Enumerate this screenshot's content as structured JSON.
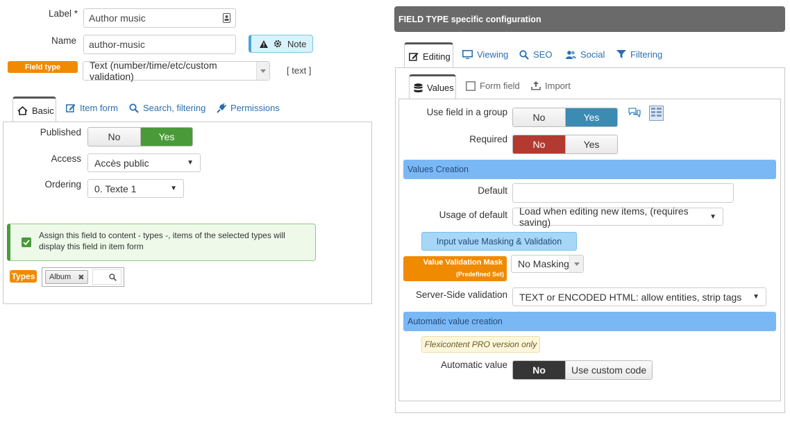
{
  "form": {
    "label_label": "Label *",
    "label_value": "Author music",
    "name_label": "Name",
    "name_value": "author-music",
    "note_label": "Note",
    "field_type_badge": "Field type",
    "field_type_value": "Text (number/time/etc/custom validation)",
    "field_type_code": "[ text ]"
  },
  "left_tabs": [
    {
      "label": "Basic",
      "icon": "home-icon"
    },
    {
      "label": "Item form",
      "icon": "edit-icon"
    },
    {
      "label": "Search, filtering",
      "icon": "search-icon"
    },
    {
      "label": "Permissions",
      "icon": "plug-icon"
    }
  ],
  "basic": {
    "published_label": "Published",
    "published_no": "No",
    "published_yes": "Yes",
    "access_label": "Access",
    "access_value": "Accès public",
    "ordering_label": "Ordering",
    "ordering_value": "0. Texte 1",
    "assign_text": "Assign this field to content - types -, items of the selected types will display this field in item form",
    "types_badge": "Types",
    "types_tag": "Album",
    "accent_green": "#4a9a3a"
  },
  "right": {
    "header": "FIELD TYPE specific configuration",
    "tabs": [
      {
        "label": "Editing",
        "icon": "edit-icon"
      },
      {
        "label": "Viewing",
        "icon": "monitor-icon"
      },
      {
        "label": "SEO",
        "icon": "search-icon"
      },
      {
        "label": "Social",
        "icon": "users-icon"
      },
      {
        "label": "Filtering",
        "icon": "filter-icon"
      }
    ],
    "subtabs": [
      {
        "label": "Values",
        "icon": "database-icon"
      },
      {
        "label": "Form field",
        "icon": "checkbox-icon"
      },
      {
        "label": "Import",
        "icon": "upload-icon"
      }
    ],
    "use_group_label": "Use field in a group",
    "use_group_no": "No",
    "use_group_yes": "Yes",
    "required_label": "Required",
    "required_no": "No",
    "required_yes": "Yes",
    "values_creation": "Values Creation",
    "default_label": "Default",
    "default_value": "",
    "usage_label": "Usage of default",
    "usage_value": "Load when editing new items, (requires saving)",
    "masking_button": "Input value Masking & Validation",
    "mask_badge_line1": "Value Validation Mask",
    "mask_badge_line2": "(Predefined Set)",
    "mask_value": "No Masking",
    "server_label": "Server-Side validation",
    "server_value": "TEXT or ENCODED HTML: allow entities, strip tags",
    "auto_creation": "Automatic value creation",
    "pro_note": "Flexicontent PRO version only",
    "auto_label": "Automatic value",
    "auto_no": "No",
    "auto_custom": "Use custom code",
    "accent_blue": "#3b8bb3",
    "accent_red": "#b33a30",
    "section_blue": "#7ab8f5"
  }
}
